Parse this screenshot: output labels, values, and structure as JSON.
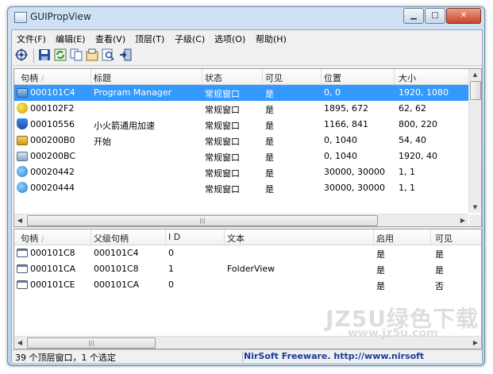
{
  "window": {
    "title": "GUIPropView"
  },
  "menu": [
    "文件(F)",
    "编辑(E)",
    "查看(V)",
    "顶层(T)",
    "子级(C)",
    "选项(O)",
    "帮助(H)"
  ],
  "toolbar": {
    "buttons": [
      "target-icon",
      "save-icon",
      "refresh-icon",
      "copy-icon",
      "properties-icon",
      "find-icon",
      "exit-icon"
    ]
  },
  "top_table": {
    "columns": [
      "句柄",
      "标题",
      "状态",
      "可见",
      "位置",
      "大小"
    ],
    "rows": [
      {
        "icon": "monitor-icon",
        "handle": "000101C4",
        "title": "Program Manager",
        "status": "常规窗口",
        "visible": "是",
        "position": "0, 0",
        "size": "1920, 1080",
        "selected": true
      },
      {
        "icon": "yellow-circle-icon",
        "handle": "000102F2",
        "title": "",
        "status": "常规窗口",
        "visible": "是",
        "position": "1895, 672",
        "size": "62, 62",
        "selected": false
      },
      {
        "icon": "shield-icon",
        "handle": "00010556",
        "title": "小火箭通用加速",
        "status": "常规窗口",
        "visible": "是",
        "position": "1166, 841",
        "size": "800, 220",
        "selected": false
      },
      {
        "icon": "start-button-icon",
        "handle": "000200B0",
        "title": "开始",
        "status": "常规窗口",
        "visible": "是",
        "position": "0, 1040",
        "size": "54, 40",
        "selected": false
      },
      {
        "icon": "taskbar-icon",
        "handle": "000200BC",
        "title": "",
        "status": "常规窗口",
        "visible": "是",
        "position": "0, 1040",
        "size": "1920, 40",
        "selected": false
      },
      {
        "icon": "globe-icon",
        "handle": "00020442",
        "title": "",
        "status": "常规窗口",
        "visible": "是",
        "position": "30000, 30000",
        "size": "1, 1",
        "selected": false
      },
      {
        "icon": "globe-icon",
        "handle": "00020444",
        "title": "",
        "status": "常规窗口",
        "visible": "是",
        "position": "30000, 30000",
        "size": "1, 1",
        "selected": false
      }
    ]
  },
  "bottom_table": {
    "columns": [
      "句柄",
      "父级句柄",
      "I D",
      "文本",
      "启用",
      "可见"
    ],
    "rows": [
      {
        "icon": "window-icon",
        "handle": "000101C8",
        "parent": "000101C4",
        "id": "0",
        "text": "",
        "enabled": "是",
        "visible": "是"
      },
      {
        "icon": "window-icon",
        "handle": "000101CA",
        "parent": "000101C8",
        "id": "1",
        "text": "FolderView",
        "enabled": "是",
        "visible": "是"
      },
      {
        "icon": "window-icon",
        "handle": "000101CE",
        "parent": "000101CA",
        "id": "0",
        "text": "",
        "enabled": "是",
        "visible": "否"
      }
    ]
  },
  "status": {
    "left": "39 个顶层窗口，1 个选定",
    "right": "NirSoft Freeware.  http://www.nirsoft"
  },
  "watermark": {
    "line1": "JZ5U绿色下载",
    "line2": "www.jz5u.com"
  },
  "colors": {
    "selection": "#3399ff",
    "link": "#1a3d9a"
  }
}
